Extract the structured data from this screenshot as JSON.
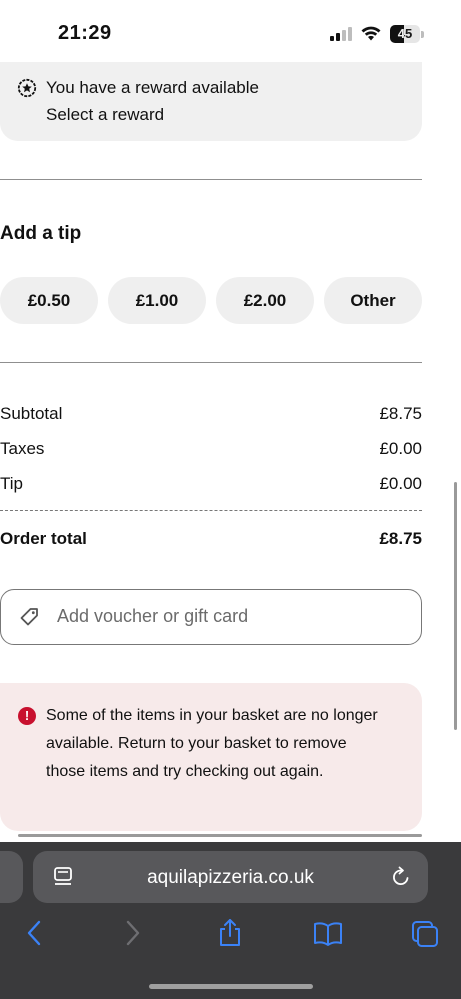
{
  "status_bar": {
    "time": "21:29",
    "battery": "45",
    "battery_level": 0.45
  },
  "reward": {
    "title": "You have a reward available",
    "link": "Select a reward"
  },
  "tip": {
    "heading": "Add a tip",
    "options": [
      "£0.50",
      "£1.00",
      "£2.00",
      "Other"
    ]
  },
  "summary": {
    "rows": [
      {
        "label": "Subtotal",
        "value": "£8.75"
      },
      {
        "label": "Taxes",
        "value": "£0.00"
      },
      {
        "label": "Tip",
        "value": "£0.00"
      }
    ],
    "total": {
      "label": "Order total",
      "value": "£8.75"
    }
  },
  "voucher": {
    "placeholder": "Add voucher or gift card"
  },
  "alert": {
    "message": "Some of the items in your basket are no longer available. Return to your basket to remove those items and try checking out again."
  },
  "browser": {
    "url": "aquilapizzeria.co.uk"
  },
  "colors": {
    "accent": "#3b82f6",
    "alert_bg": "#f7eaea",
    "alert_icon": "#c8102e",
    "chip_bg": "#efefef"
  }
}
